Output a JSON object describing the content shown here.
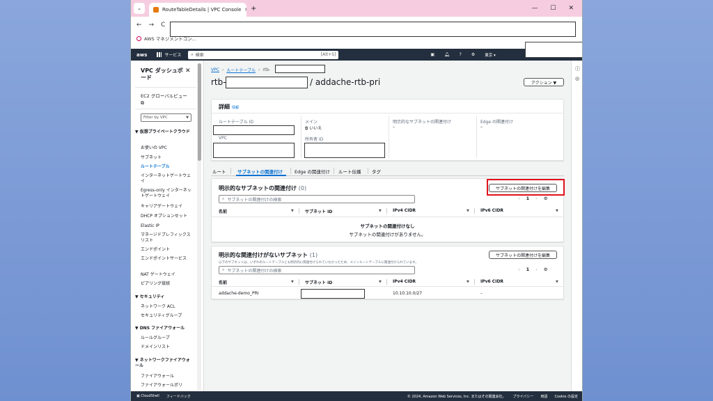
{
  "browser": {
    "tab_title": "RouteTableDetails | VPC Console",
    "bookmark": "AWS マネジメントコン..."
  },
  "aws_nav": {
    "logo": "aws",
    "services": "サービス",
    "search_placeholder": "検索",
    "search_shortcut": "[Alt+S]",
    "region": "東京 ▾"
  },
  "sidebar": {
    "title": "VPC ダッシュボード",
    "ec2_global_view": "EC2 グローバルビュー",
    "filter_placeholder": "Filter by VPC",
    "sections": [
      {
        "label": "▼ 仮想プライベートクラウド"
      },
      {
        "label": "▼ セキュリティ"
      },
      {
        "label": "▼ DNS ファイアウォール"
      },
      {
        "label": "▼ ネットワークファイアウォール"
      }
    ],
    "items": [
      "お使いの VPC",
      "サブネット",
      "ルートテーブル",
      "インターネットゲートウェイ",
      "Egress-only インターネットゲートウェイ",
      "キャリアゲートウェイ",
      "DHCP オプションセット",
      "Elastic IP",
      "マネージドプレフィックスリスト",
      "エンドポイント",
      "エンドポイントサービス",
      "NAT ゲートウェイ",
      "ピアリング接続",
      "ネットワーク ACL",
      "セキュリティグループ",
      "ルールグループ",
      "ドメインリスト",
      "ファイアウォール",
      "ファイアウォールポリ"
    ]
  },
  "breadcrumb": {
    "vpc": "VPC",
    "route_tables": "ルートテーブル",
    "current": "rtb-"
  },
  "page": {
    "title_prefix": "rtb-",
    "title_suffix": "/ addache-rtb-pri",
    "actions_button": "アクション ▼"
  },
  "details": {
    "heading": "詳細",
    "info": "情報",
    "route_table_id_label": "ルートテーブル ID",
    "main_label": "メイン",
    "main_value": "いいえ",
    "explicit_subnet_label": "明示的なサブネットの関連付け",
    "explicit_subnet_value": "–",
    "edge_label": "Edge の関連付け",
    "edge_value": "–",
    "vpc_label": "VPC",
    "owner_label": "所有者 ID"
  },
  "tabs": [
    "ルート",
    "サブネットの関連付け",
    "Edge の関連付け",
    "ルート伝播",
    "タグ"
  ],
  "explicit_panel": {
    "title": "明示的なサブネットの関連付け",
    "count": "(0)",
    "edit_button": "サブネットの関連付けを編集",
    "search_placeholder": "サブネットの関連付けの検索",
    "page": "1",
    "columns": [
      "名前",
      "サブネット ID",
      "IPv4 CIDR",
      "IPv6 CIDR"
    ],
    "empty_title": "サブネットの関連付けなし",
    "empty_body": "サブネットの関連付けがありません。"
  },
  "implicit_panel": {
    "title": "明示的な関連付けがないサブネット",
    "count": "(1)",
    "description": "以下のサブネットは、いずれのルートテーブルとも明示的に関連付けられていなかったため、メインルートテーブルに関連付けられています。",
    "edit_button": "サブネットの関連付けを編集",
    "search_placeholder": "サブネットの関連付けの検索",
    "page": "1",
    "columns": [
      "名前",
      "サブネット ID",
      "IPv4 CIDR",
      "IPv6 CIDR"
    ],
    "row": {
      "name": "addache-demo_PRI",
      "ipv4": "10.10.10.0/27",
      "ipv6": "–"
    }
  },
  "footer": {
    "cloudshell": "CloudShell",
    "feedback": "フィードバック",
    "copyright": "© 2024, Amazon Web Services, Inc. またはその関連会社。",
    "privacy": "プライバシー",
    "terms": "用語",
    "cookie": "Cookie の設定"
  },
  "colors": {
    "aws_nav": "#232f3e",
    "link": "#0972d3",
    "highlight": "#e0121b",
    "tab_strip": "#f6cde0"
  }
}
